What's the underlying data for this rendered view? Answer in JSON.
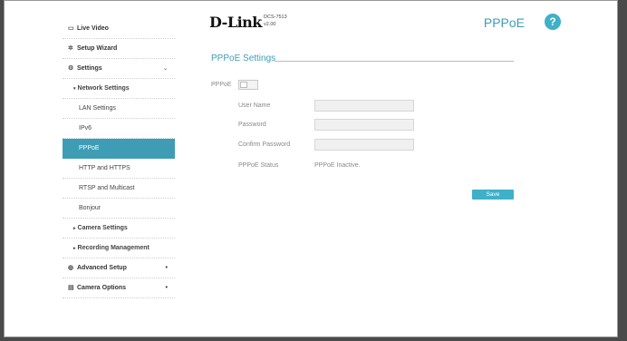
{
  "header": {
    "brand": "D-Link",
    "model": "DCS-7513",
    "version": "v2.00",
    "page_title": "PPPoE",
    "help_symbol": "?"
  },
  "sidebar": {
    "items": [
      {
        "label": "Live Video",
        "icon": "video-icon"
      },
      {
        "label": "Setup Wizard",
        "icon": "wand-icon"
      },
      {
        "label": "Settings",
        "icon": "gear-icon"
      },
      {
        "label": "Network Settings"
      },
      {
        "label": "LAN Settings"
      },
      {
        "label": "IPv6"
      },
      {
        "label": "PPPoE"
      },
      {
        "label": "HTTP and HTTPS"
      },
      {
        "label": "RTSP and Multicast"
      },
      {
        "label": "Bonjour"
      },
      {
        "label": "Camera Settings"
      },
      {
        "label": "Recording Management"
      },
      {
        "label": "Advanced Setup",
        "icon": "advanced-icon"
      },
      {
        "label": "Camera Options",
        "icon": "camera-options-icon"
      }
    ]
  },
  "main": {
    "section_title": "PPPoE Settings",
    "toggle_label": "PPPoE",
    "fields": {
      "username_label": "User Name",
      "password_label": "Password",
      "confirm_label": "Confirm Password",
      "status_label": "PPPoE Status",
      "status_value": "PPPoE Inactive.",
      "username_value": "",
      "password_value": "",
      "confirm_value": ""
    },
    "save_label": "Save"
  },
  "colors": {
    "accent": "#3e9db5",
    "button": "#3eb1c8",
    "background_outer": "#4a4a4a"
  }
}
